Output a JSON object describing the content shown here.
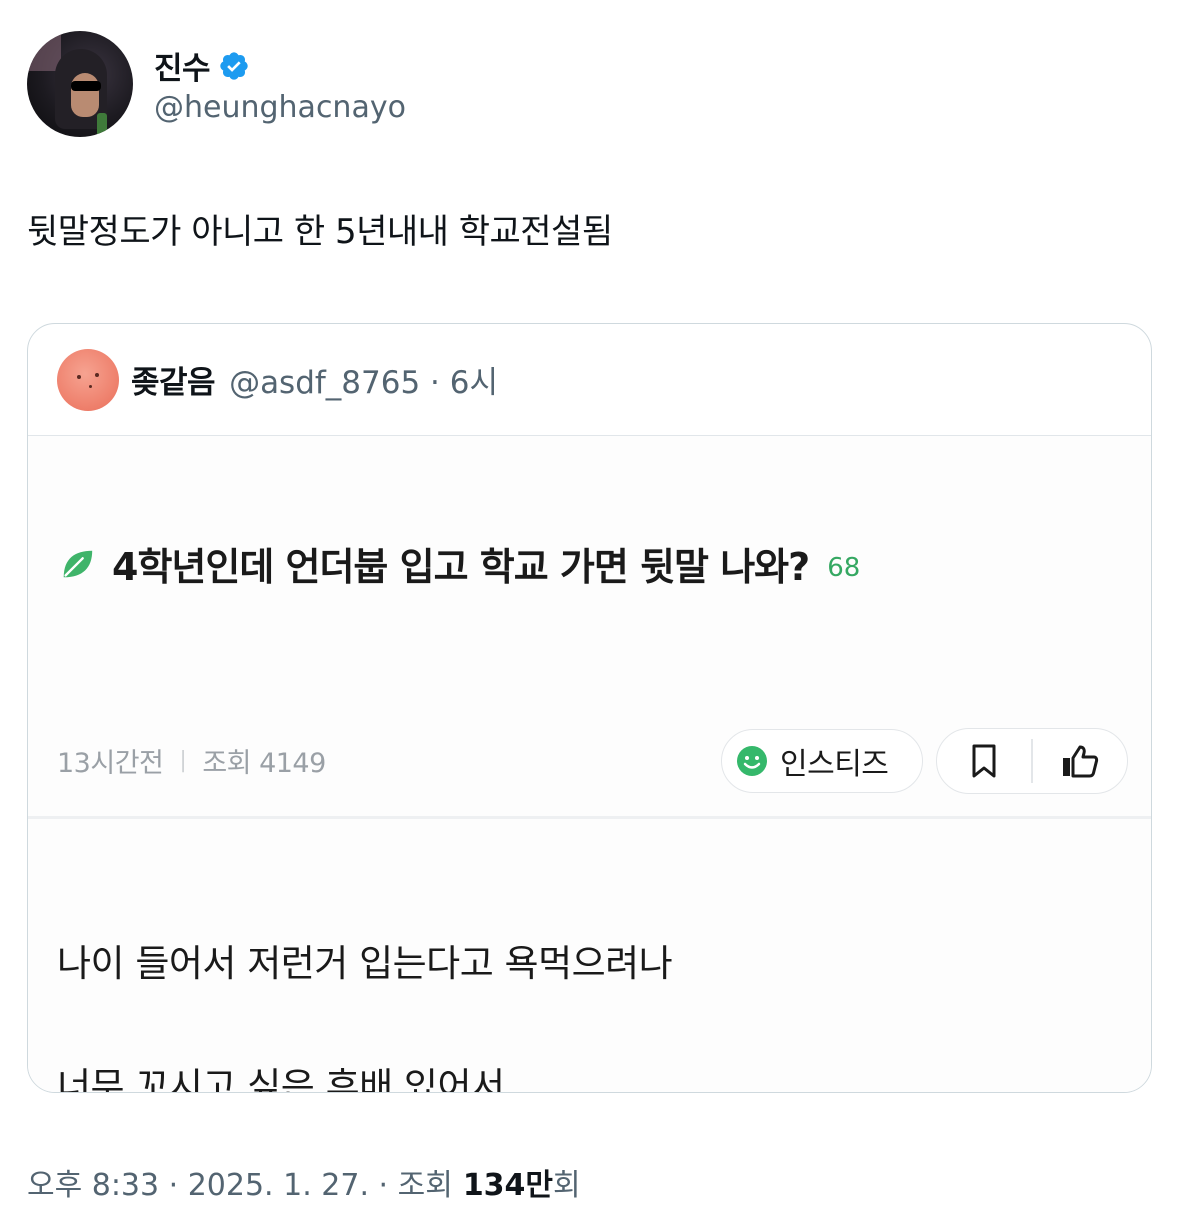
{
  "author": {
    "name": "진수",
    "handle": "@heunghacnayo",
    "verified_icon": "verified-badge-icon",
    "verified_color": "#1d9bf0"
  },
  "tweet": {
    "text": "뒷말정도가 아니고 한 5년내내 학교전설됨"
  },
  "quote": {
    "name": "좆같음",
    "meta": "@asdf_8765 · 6시",
    "post": {
      "title": "4학년인데 언더붑 입고 학교 가면 뒷말 나와?",
      "comments": "68",
      "time": "13시간전",
      "views": "조회 4149",
      "channel": "인스티즈",
      "lines": [
        "나이 들어서 저런거 입는다고 욕먹으려나",
        "너무 꼬시고 싶은 후배 있어서"
      ],
      "accent_color": "#35a862"
    }
  },
  "footer": {
    "time": "오후 8:33 · 2025. 1. 27. · 조회",
    "views_bold": "134만",
    "views_suffix": "회"
  }
}
